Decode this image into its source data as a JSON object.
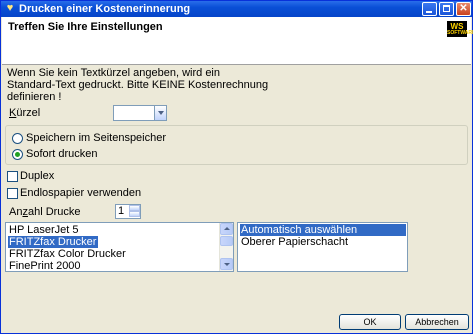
{
  "window": {
    "title": "Drucken einer Kostenerinnerung",
    "icon": "printer-bulb-icon"
  },
  "header": {
    "title": "Treffen Sie Ihre Einstellungen",
    "logo": {
      "main": "WS",
      "sub": "SOFTWARE"
    }
  },
  "info": {
    "lines": [
      "Wenn Sie kein Textkürzel angeben, wird ein",
      "Standard-Text gedruckt. Bitte KEINE Kostenrechnung",
      "definieren !"
    ]
  },
  "kuerzel": {
    "label_underlined": "K",
    "label_rest": "ürzel",
    "value": ""
  },
  "output_mode": {
    "options": [
      "Speichern im Seitenspeicher",
      "Sofort drucken"
    ],
    "selected": "Sofort drucken"
  },
  "duplex": {
    "label": "Duplex",
    "checked": false
  },
  "endlos": {
    "label": "Endlospapier verwenden",
    "checked": false
  },
  "copies": {
    "label_prefix": "An",
    "label_underlined": "z",
    "label_rest": "ahl Drucke",
    "value": "1"
  },
  "printers": {
    "items": [
      "HP LaserJet 5",
      "FRITZfax Drucker",
      "FRITZfax Color Drucker",
      "FinePrint 2000"
    ],
    "selected": "FRITZfax Drucker"
  },
  "trays": {
    "items": [
      "Automatisch auswählen",
      "Oberer Papierschacht"
    ],
    "selected": "Automatisch auswählen"
  },
  "buttons": {
    "ok": "OK",
    "cancel": "Abbrechen"
  },
  "colors": {
    "titlebar": "#0A4FD6",
    "selection": "#316AC5",
    "dialog_bg": "#ECE9D8"
  }
}
